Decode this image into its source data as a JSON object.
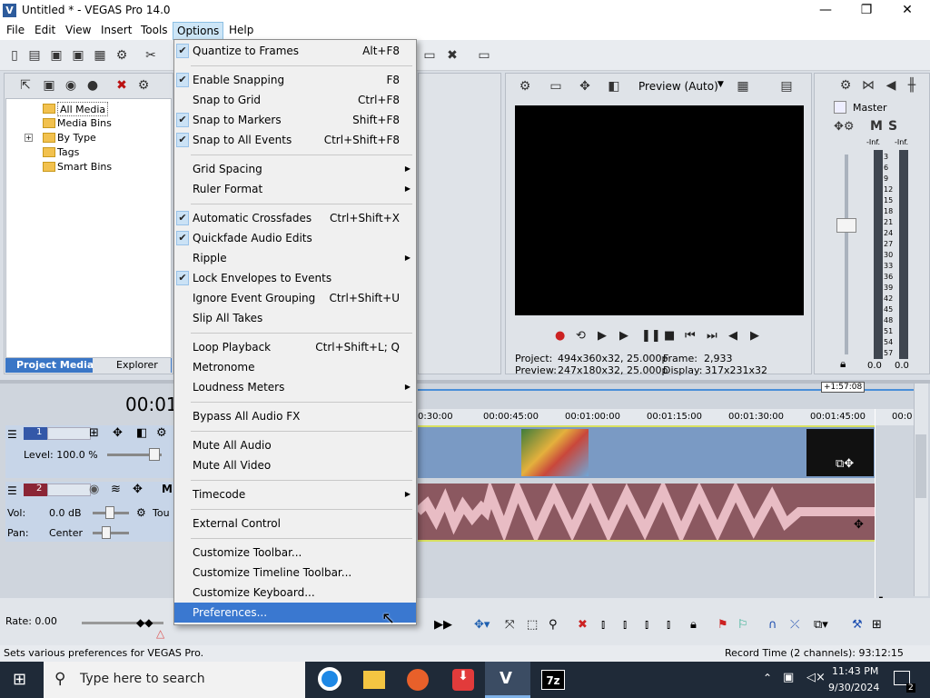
{
  "window": {
    "title": "Untitled * - VEGAS Pro 14.0",
    "minimize": "—",
    "maximize": "❐",
    "close": "✕"
  },
  "menubar": [
    "File",
    "Edit",
    "View",
    "Insert",
    "Tools",
    "Options",
    "Help"
  ],
  "project_media": {
    "tree": [
      "All Media",
      "Media Bins",
      "By Type",
      "Tags",
      "Smart Bins"
    ],
    "tabs": [
      "Project Media",
      "Explorer"
    ]
  },
  "preview": {
    "mode": "Preview (Auto)",
    "project_label": "Project:",
    "project_value": "494x360x32, 25.000p",
    "preview_label": "Preview:",
    "preview_value": "247x180x32, 25.000p",
    "frame_label": "Frame:",
    "frame_value": "2,933",
    "display_label": "Display:",
    "display_value": "317x231x32"
  },
  "mixer": {
    "title": "Master",
    "m": "M",
    "s": "S",
    "inf_left": "-Inf.",
    "inf_right": "-Inf.",
    "scale": [
      "3",
      "6",
      "9",
      "12",
      "15",
      "18",
      "21",
      "24",
      "27",
      "30",
      "33",
      "36",
      "39",
      "42",
      "45",
      "48",
      "51",
      "54",
      "57"
    ],
    "bottom_left": "0.0",
    "bottom_right": "0.0"
  },
  "timeline": {
    "timecode": "00:01",
    "end_marker": "+1:57:08",
    "ruler": [
      "0:30:00",
      "00:00:45:00",
      "00:01:00:00",
      "00:01:15:00",
      "00:01:30:00",
      "00:01:45:00",
      "00:0"
    ],
    "track1": {
      "num": "1",
      "level": "Level: 100.0 %"
    },
    "track2": {
      "num": "2",
      "vol_label": "Vol:",
      "vol_value": "0.0 dB",
      "pan_label": "Pan:",
      "pan_value": "Center",
      "touch": "Tou"
    }
  },
  "rate": "Rate: 0.00",
  "status": {
    "hint": "Sets various preferences for VEGAS Pro.",
    "record": "Record Time (2 channels): 93:12:15"
  },
  "taskbar": {
    "search_placeholder": "Type here to search",
    "time": "11:43 PM",
    "date": "9/30/2024",
    "notif": "2"
  },
  "options_menu": [
    {
      "label": "Quantize to Frames",
      "shortcut": "Alt+F8",
      "checked": true
    },
    {
      "sep": true
    },
    {
      "label": "Enable Snapping",
      "shortcut": "F8",
      "checked": true
    },
    {
      "label": "Snap to Grid",
      "shortcut": "Ctrl+F8",
      "checked": false
    },
    {
      "label": "Snap to Markers",
      "shortcut": "Shift+F8",
      "checked": true
    },
    {
      "label": "Snap to All Events",
      "shortcut": "Ctrl+Shift+F8",
      "checked": true
    },
    {
      "sep": true
    },
    {
      "label": "Grid Spacing",
      "submenu": true
    },
    {
      "label": "Ruler Format",
      "submenu": true
    },
    {
      "sep": true
    },
    {
      "label": "Automatic Crossfades",
      "shortcut": "Ctrl+Shift+X",
      "checked": true
    },
    {
      "label": "Quickfade Audio Edits",
      "checked": true
    },
    {
      "label": "Ripple",
      "submenu": true
    },
    {
      "label": "Lock Envelopes to Events",
      "checked": true
    },
    {
      "label": "Ignore Event Grouping",
      "shortcut": "Ctrl+Shift+U"
    },
    {
      "label": "Slip All Takes"
    },
    {
      "sep": true
    },
    {
      "label": "Loop Playback",
      "shortcut": "Ctrl+Shift+L; Q"
    },
    {
      "label": "Metronome"
    },
    {
      "label": "Loudness Meters",
      "submenu": true
    },
    {
      "sep": true
    },
    {
      "label": "Bypass All Audio FX"
    },
    {
      "sep": true
    },
    {
      "label": "Mute All Audio"
    },
    {
      "label": "Mute All Video"
    },
    {
      "sep": true
    },
    {
      "label": "Timecode",
      "submenu": true
    },
    {
      "sep": true
    },
    {
      "label": "External Control"
    },
    {
      "sep": true
    },
    {
      "label": "Customize Toolbar..."
    },
    {
      "label": "Customize Timeline Toolbar..."
    },
    {
      "label": "Customize Keyboard..."
    },
    {
      "label": "Preferences...",
      "selected": true
    }
  ]
}
